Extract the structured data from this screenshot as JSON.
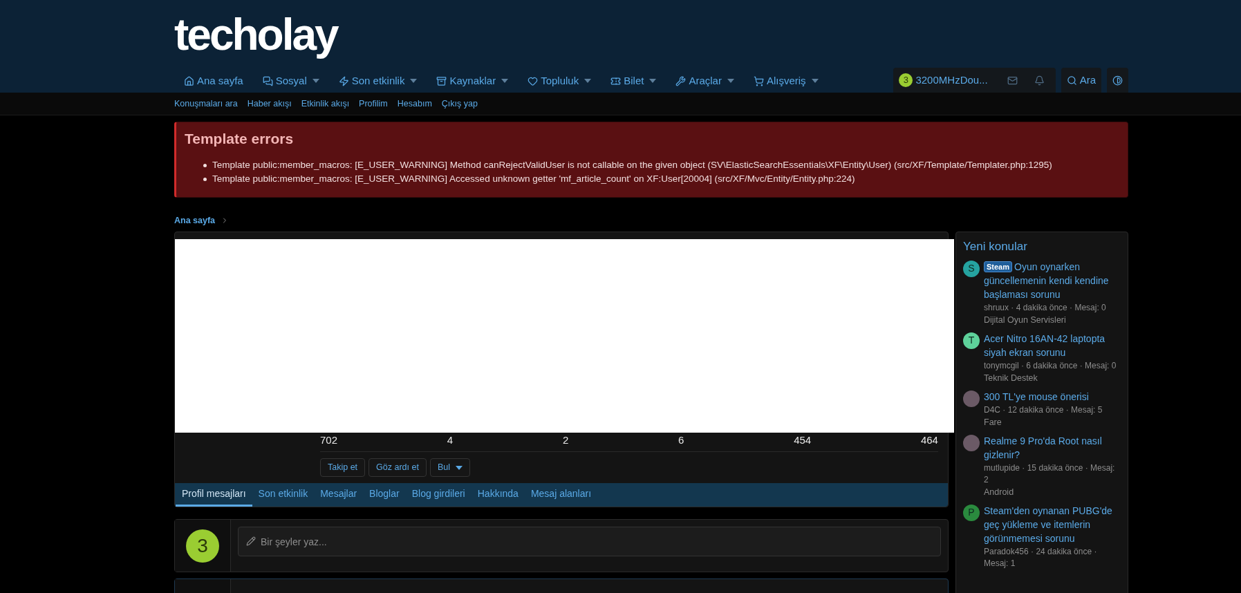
{
  "logo": "techolay",
  "nav": [
    {
      "label": "Ana sayfa",
      "dropdown": false
    },
    {
      "label": "Sosyal",
      "dropdown": true
    },
    {
      "label": "Son etkinlik",
      "dropdown": true
    },
    {
      "label": "Kaynaklar",
      "dropdown": true
    },
    {
      "label": "Topluluk",
      "dropdown": true
    },
    {
      "label": "Bilet",
      "dropdown": true
    },
    {
      "label": "Araçlar",
      "dropdown": true
    },
    {
      "label": "Alışveriş",
      "dropdown": true
    }
  ],
  "user": {
    "avatar": "3",
    "name": "3200MHzDou..."
  },
  "search": {
    "label": "Ara"
  },
  "subnav": [
    "Konuşmaları ara",
    "Haber akışı",
    "Etkinlik akışı",
    "Profilim",
    "Hesabım",
    "Çıkış yap"
  ],
  "error_box": {
    "title": "Template errors",
    "items": [
      "Template public:member_macros: [E_USER_WARNING] Method canRejectValidUser is not callable on the given object (SV\\ElasticSearchEssentials\\XF\\Entity\\User) (src/XF/Template/Templater.php:1295)",
      "Template public:member_macros: [E_USER_WARNING] Accessed unknown getter 'mf_article_count' on XF:User[20004] (src/XF/Mvc/Entity/Entity.php:224)"
    ]
  },
  "breadcrumb": [
    "Ana sayfa"
  ],
  "profile": {
    "stats": [
      "702",
      "4",
      "2",
      "6",
      "454",
      "464"
    ],
    "buttons": [
      {
        "label": "Takip et",
        "dropdown": false
      },
      {
        "label": "Göz ardı et",
        "dropdown": false
      },
      {
        "label": "Bul",
        "dropdown": true
      }
    ],
    "tabs": [
      {
        "label": "Profil mesajları",
        "selected": true
      },
      {
        "label": "Son etkinlik",
        "selected": false
      },
      {
        "label": "Mesajlar",
        "selected": false
      },
      {
        "label": "Bloglar",
        "selected": false
      },
      {
        "label": "Blog girdileri",
        "selected": false
      },
      {
        "label": "Hakkında",
        "selected": false
      },
      {
        "label": "Mesaj alanları",
        "selected": false
      }
    ]
  },
  "composer": {
    "avatar": "3",
    "placeholder": "Bir şeyler yaz..."
  },
  "sidebar": {
    "title": "Yeni konular",
    "items": [
      {
        "kind": "letter",
        "avatar": "S",
        "color": "#25a3a0",
        "tag": "Steam",
        "title": "Oyun oynarken güncellemenin kendi kendine başlaması sorunu",
        "meta": "shruux · 4 dakika önce · Mesaj: 0",
        "forum": "Dijital Oyun Servisleri"
      },
      {
        "kind": "letter",
        "avatar": "T",
        "color": "#5ed19a",
        "title": "Acer Nitro 16AN-42 laptopta siyah ekran sorunu",
        "meta": "tonymcgil · 6 dakika önce · Mesaj: 0",
        "forum": "Teknik Destek"
      },
      {
        "kind": "image",
        "title": "300 TL'ye mouse önerisi",
        "meta": "D4C · 12 dakika önce · Mesaj: 5",
        "forum": "Fare"
      },
      {
        "kind": "image",
        "title": "Realme 9 Pro'da Root nasıl gizlenir?",
        "meta": "mutlupide · 15 dakika önce · Mesaj: 2",
        "forum": "Android"
      },
      {
        "kind": "letter",
        "avatar": "P",
        "color": "#2a8a3e",
        "title": "Steam'den oynanan PUBG'de geç yükleme ve itemlerin görünmemesi sorunu",
        "meta": "Paradok456 · 24 dakika önce · Mesaj: 1"
      }
    ]
  }
}
